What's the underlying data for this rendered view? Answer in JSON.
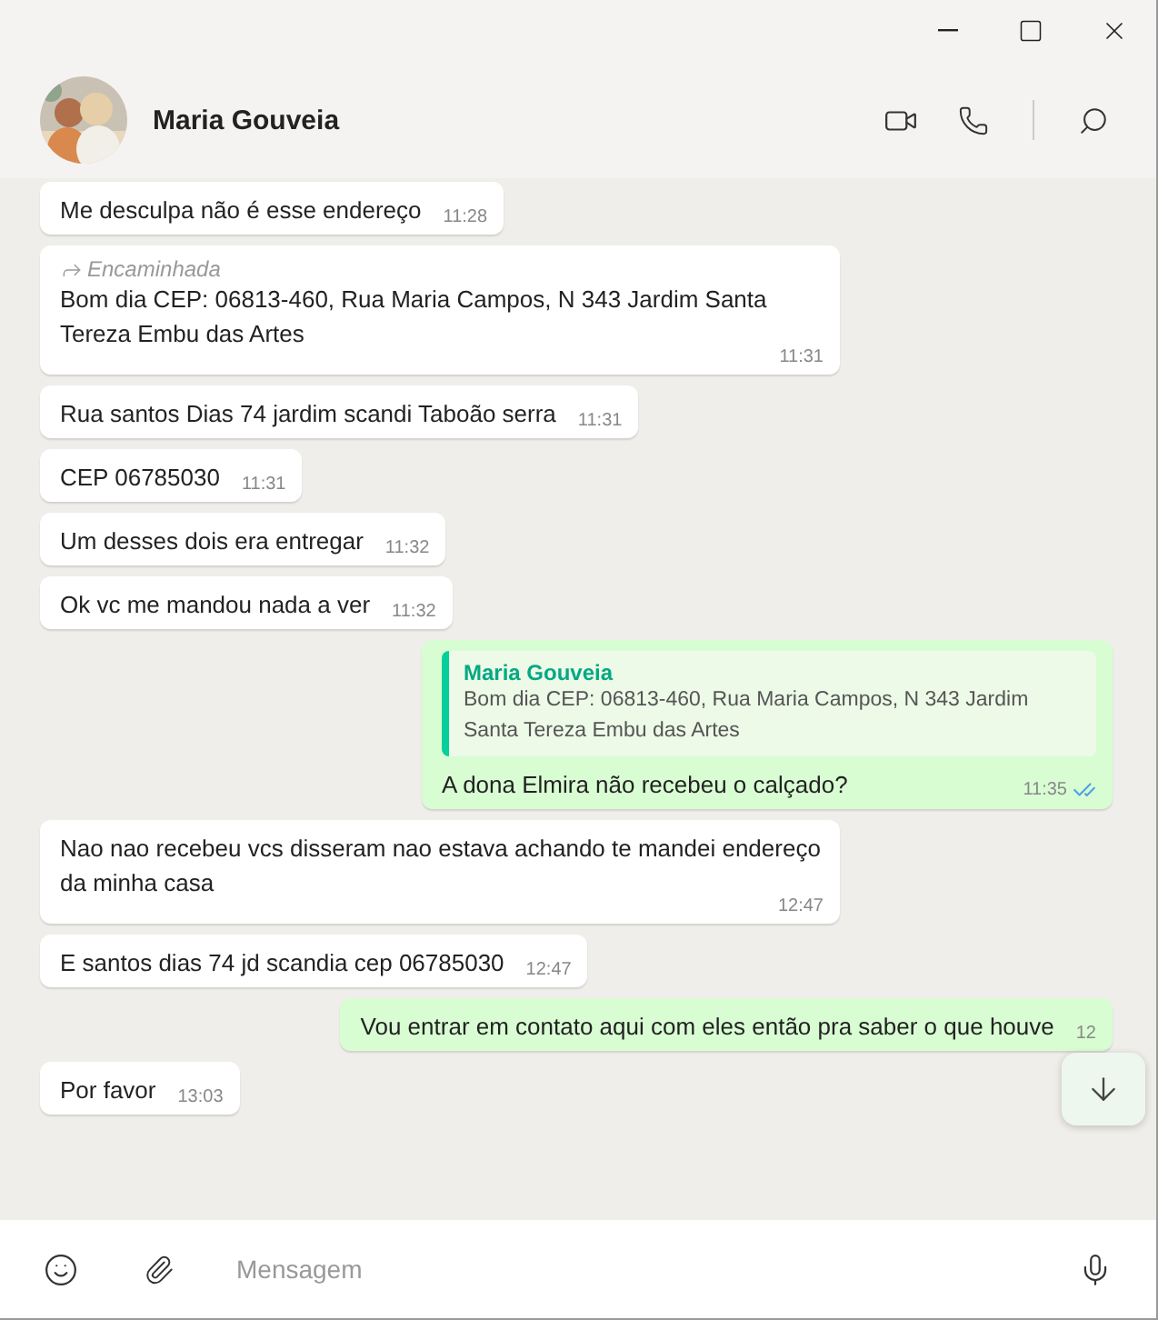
{
  "contact": {
    "name": "Maria Gouveia"
  },
  "messages": [
    {
      "kind": "incoming",
      "text": "Me desculpa não é esse endereço",
      "time": "11:28"
    },
    {
      "kind": "incoming",
      "forwarded": true,
      "forward_label": "Encaminhada",
      "text": "Bom dia CEP: 06813-460, Rua Maria Campos, N 343 Jardim Santa Tereza Embu das Artes",
      "time": "11:31"
    },
    {
      "kind": "incoming",
      "text": "Rua santos Dias 74 jardim scandi Taboão serra",
      "time": "11:31"
    },
    {
      "kind": "incoming",
      "text": "CEP 06785030",
      "time": "11:31"
    },
    {
      "kind": "incoming",
      "text": "Um desses dois era entregar",
      "time": "11:32"
    },
    {
      "kind": "incoming",
      "text": "Ok vc me mandou nada a ver",
      "time": "11:32"
    },
    {
      "kind": "outgoing",
      "quote": {
        "author": "Maria Gouveia",
        "text": "Bom dia CEP: 06813-460, Rua Maria Campos, N 343 Jardim Santa Tereza Embu das Artes"
      },
      "text": "A dona Elmira não recebeu o calçado?",
      "time": "11:35",
      "read": true
    },
    {
      "kind": "incoming",
      "text": "Nao nao recebeu vcs disseram nao estava achando  te mandei endereço da minha casa",
      "time": "12:47"
    },
    {
      "kind": "incoming",
      "text": "E santos dias 74 jd scandia cep 06785030",
      "time": "12:47"
    },
    {
      "kind": "outgoing",
      "text": "Vou entrar em contato aqui com eles então pra saber o que houve",
      "time": "12"
    },
    {
      "kind": "incoming",
      "text": "Por favor",
      "time": "13:03"
    }
  ],
  "composer": {
    "placeholder": "Mensagem"
  }
}
